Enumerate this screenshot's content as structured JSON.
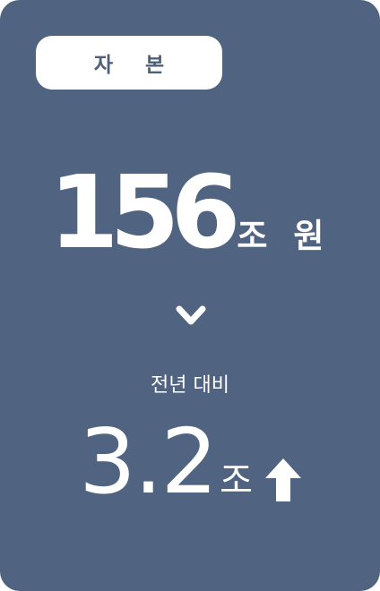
{
  "badge": {
    "label": "자 본"
  },
  "main": {
    "value": "156",
    "unit": "조 원"
  },
  "icons": {
    "chevron": "chevron-down-icon",
    "trend": "arrow-up-icon"
  },
  "comparison": {
    "label": "전년 대비",
    "value": "3.2",
    "unit": "조",
    "direction": "up"
  },
  "colors": {
    "card": "#506482",
    "pill": "#ffffff",
    "pill_text": "#4e5f78",
    "text": "#ffffff"
  }
}
